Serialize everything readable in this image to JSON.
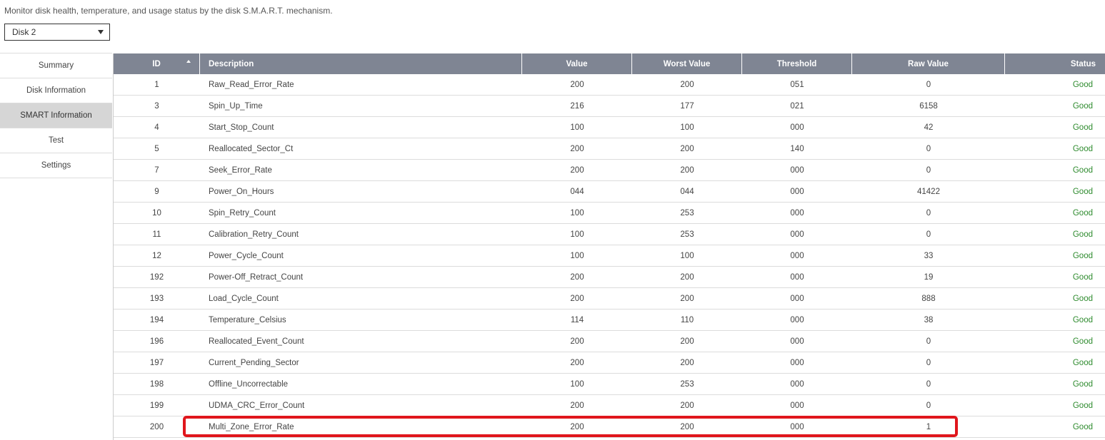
{
  "page": {
    "description": "Monitor disk health, temperature, and usage status by the disk S.M.A.R.T. mechanism."
  },
  "disk_select": {
    "selected": "Disk 2"
  },
  "sidebar": {
    "items": [
      {
        "label": "Summary",
        "active": false
      },
      {
        "label": "Disk Information",
        "active": false
      },
      {
        "label": "SMART Information",
        "active": true
      },
      {
        "label": "Test",
        "active": false
      },
      {
        "label": "Settings",
        "active": false
      }
    ]
  },
  "table": {
    "headers": {
      "id": "ID",
      "description": "Description",
      "value": "Value",
      "worst_value": "Worst Value",
      "threshold": "Threshold",
      "raw_value": "Raw Value",
      "status": "Status"
    },
    "rows": [
      {
        "id": "1",
        "description": "Raw_Read_Error_Rate",
        "value": "200",
        "worst_value": "200",
        "threshold": "051",
        "raw_value": "0",
        "status": "Good"
      },
      {
        "id": "3",
        "description": "Spin_Up_Time",
        "value": "216",
        "worst_value": "177",
        "threshold": "021",
        "raw_value": "6158",
        "status": "Good"
      },
      {
        "id": "4",
        "description": "Start_Stop_Count",
        "value": "100",
        "worst_value": "100",
        "threshold": "000",
        "raw_value": "42",
        "status": "Good"
      },
      {
        "id": "5",
        "description": "Reallocated_Sector_Ct",
        "value": "200",
        "worst_value": "200",
        "threshold": "140",
        "raw_value": "0",
        "status": "Good"
      },
      {
        "id": "7",
        "description": "Seek_Error_Rate",
        "value": "200",
        "worst_value": "200",
        "threshold": "000",
        "raw_value": "0",
        "status": "Good"
      },
      {
        "id": "9",
        "description": "Power_On_Hours",
        "value": "044",
        "worst_value": "044",
        "threshold": "000",
        "raw_value": "41422",
        "status": "Good"
      },
      {
        "id": "10",
        "description": "Spin_Retry_Count",
        "value": "100",
        "worst_value": "253",
        "threshold": "000",
        "raw_value": "0",
        "status": "Good"
      },
      {
        "id": "11",
        "description": "Calibration_Retry_Count",
        "value": "100",
        "worst_value": "253",
        "threshold": "000",
        "raw_value": "0",
        "status": "Good"
      },
      {
        "id": "12",
        "description": "Power_Cycle_Count",
        "value": "100",
        "worst_value": "100",
        "threshold": "000",
        "raw_value": "33",
        "status": "Good"
      },
      {
        "id": "192",
        "description": "Power-Off_Retract_Count",
        "value": "200",
        "worst_value": "200",
        "threshold": "000",
        "raw_value": "19",
        "status": "Good"
      },
      {
        "id": "193",
        "description": "Load_Cycle_Count",
        "value": "200",
        "worst_value": "200",
        "threshold": "000",
        "raw_value": "888",
        "status": "Good"
      },
      {
        "id": "194",
        "description": "Temperature_Celsius",
        "value": "114",
        "worst_value": "110",
        "threshold": "000",
        "raw_value": "38",
        "status": "Good"
      },
      {
        "id": "196",
        "description": "Reallocated_Event_Count",
        "value": "200",
        "worst_value": "200",
        "threshold": "000",
        "raw_value": "0",
        "status": "Good"
      },
      {
        "id": "197",
        "description": "Current_Pending_Sector",
        "value": "200",
        "worst_value": "200",
        "threshold": "000",
        "raw_value": "0",
        "status": "Good"
      },
      {
        "id": "198",
        "description": "Offline_Uncorrectable",
        "value": "100",
        "worst_value": "253",
        "threshold": "000",
        "raw_value": "0",
        "status": "Good"
      },
      {
        "id": "199",
        "description": "UDMA_CRC_Error_Count",
        "value": "200",
        "worst_value": "200",
        "threshold": "000",
        "raw_value": "0",
        "status": "Good"
      },
      {
        "id": "200",
        "description": "Multi_Zone_Error_Rate",
        "value": "200",
        "worst_value": "200",
        "threshold": "000",
        "raw_value": "1",
        "status": "Good"
      }
    ]
  },
  "colors": {
    "header_bg": "#7f8593",
    "status_good": "#2e8b2e",
    "highlight": "#e0161c",
    "sidebar_active": "#d6d6d6"
  },
  "icons": {
    "sort": "sort-ascending-icon",
    "dropdown": "chevron-down-icon"
  }
}
